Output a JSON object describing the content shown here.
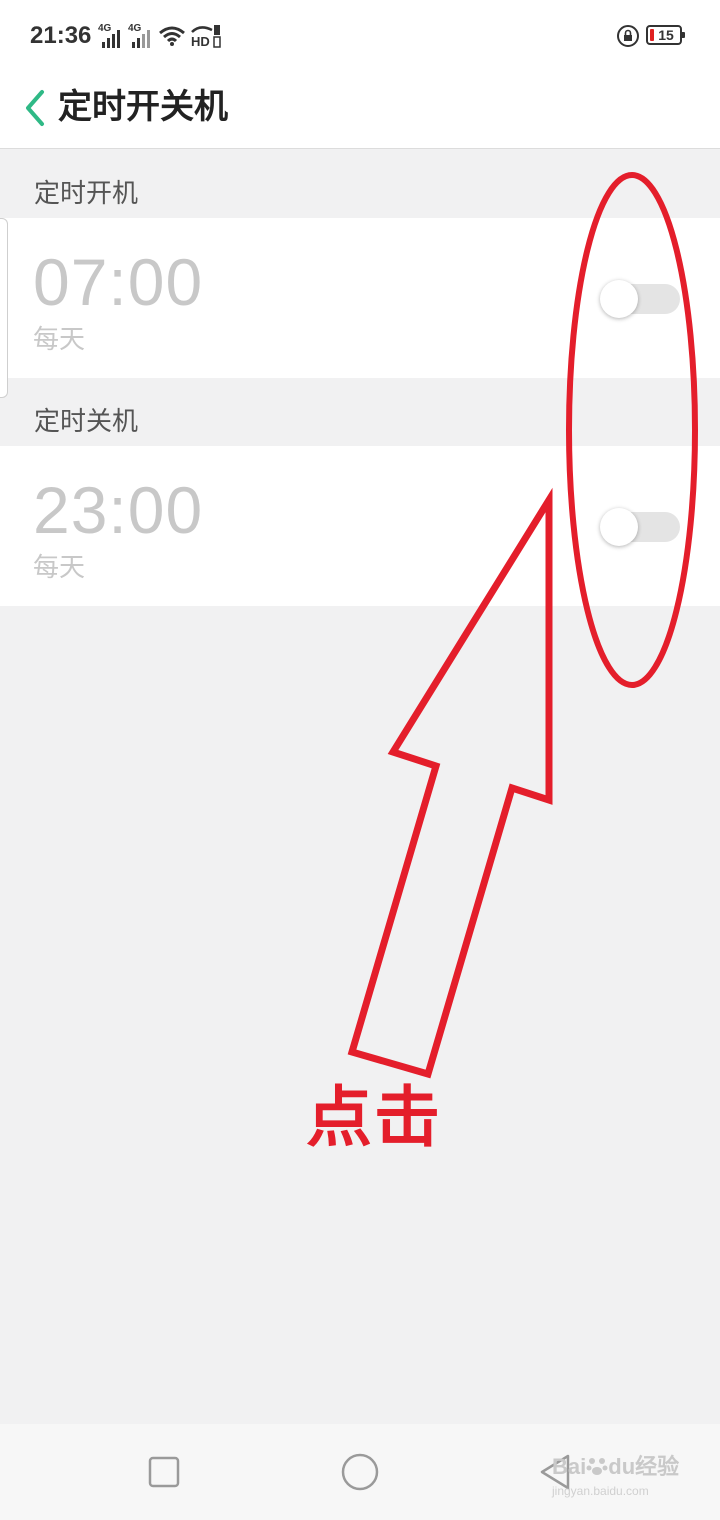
{
  "status_bar": {
    "time": "21:36",
    "network_1": "4G",
    "network_2": "4G",
    "hd_label": "HD",
    "battery_level": "15",
    "icons": [
      "signal-icon",
      "wifi-icon",
      "hd-voice-icon",
      "rotation-lock-icon",
      "battery-icon"
    ]
  },
  "title_bar": {
    "title": "定时开关机",
    "back_icon": "chevron-left-icon",
    "accent_color": "#2fb986"
  },
  "power_on": {
    "header": "定时开机",
    "time": "07:00",
    "repeat": "每天",
    "enabled": false
  },
  "power_off": {
    "header": "定时关机",
    "time": "23:00",
    "repeat": "每天",
    "enabled": false
  },
  "annotation": {
    "text": "点击",
    "color": "#e41e2b"
  },
  "nav_bar": {
    "recents_icon": "square-icon",
    "home_icon": "circle-icon",
    "back_icon": "triangle-back-icon"
  },
  "watermark": {
    "brand": "Bai",
    "brand_2": "du",
    "suffix": "经验",
    "url": "jingyan.baidu.com"
  }
}
